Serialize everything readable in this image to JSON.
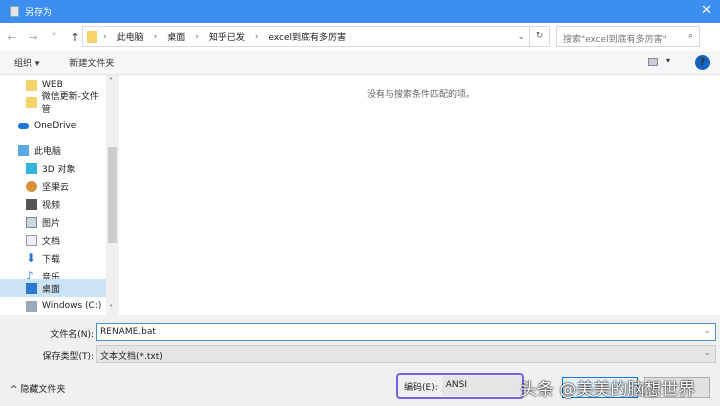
{
  "window": {
    "title": "另存为",
    "close": "✕"
  },
  "nav": {
    "back": "←",
    "forward": "→",
    "recent": "˅",
    "up": "↑",
    "breadcrumbs": [
      "此电脑",
      "桌面",
      "知乎已发",
      "excel到底有多厉害"
    ],
    "separator": "›",
    "dropdown": "⌄",
    "refresh": "↻",
    "search_placeholder": "搜索\"excel到底有多厉害\"",
    "search_icon": "⌕"
  },
  "toolbar": {
    "organize": "组织 ▾",
    "new_folder": "新建文件夹",
    "view_dd": "▾",
    "help": "?"
  },
  "sidebar": {
    "items": [
      {
        "label": "WEB",
        "icon": "folder-icon"
      },
      {
        "label": "微信更新-文件管",
        "icon": "folder-icon"
      },
      {
        "label": "OneDrive",
        "icon": "cloud-icon"
      },
      {
        "label": "此电脑",
        "icon": "computer-icon"
      },
      {
        "label": "3D 对象",
        "icon": "cube-icon"
      },
      {
        "label": "坚果云",
        "icon": "nut-icon"
      },
      {
        "label": "视频",
        "icon": "video-icon"
      },
      {
        "label": "图片",
        "icon": "picture-icon"
      },
      {
        "label": "文档",
        "icon": "document-icon"
      },
      {
        "label": "下载",
        "icon": "download-icon"
      },
      {
        "label": "音乐",
        "icon": "music-icon"
      },
      {
        "label": "桌面",
        "icon": "desktop-icon"
      },
      {
        "label": "Windows (C:)",
        "icon": "drive-icon"
      }
    ]
  },
  "content": {
    "empty_message": "没有与搜索条件匹配的项。"
  },
  "form": {
    "filename_label": "文件名(N):",
    "filename_value": "RENAME.bat",
    "filetype_label": "保存类型(T):",
    "filetype_value": "文本文档(*.txt)",
    "dropdown": "⌄",
    "hide_folders": "^ 隐藏文件夹",
    "encoding_label": "编码(E):",
    "encoding_value": "ANSI"
  },
  "watermark": "头条 @美美的脑想世界",
  "colors": {
    "title": "#3c8ff0",
    "selected": "#cce4f7",
    "highlight": "#7b61e0"
  }
}
